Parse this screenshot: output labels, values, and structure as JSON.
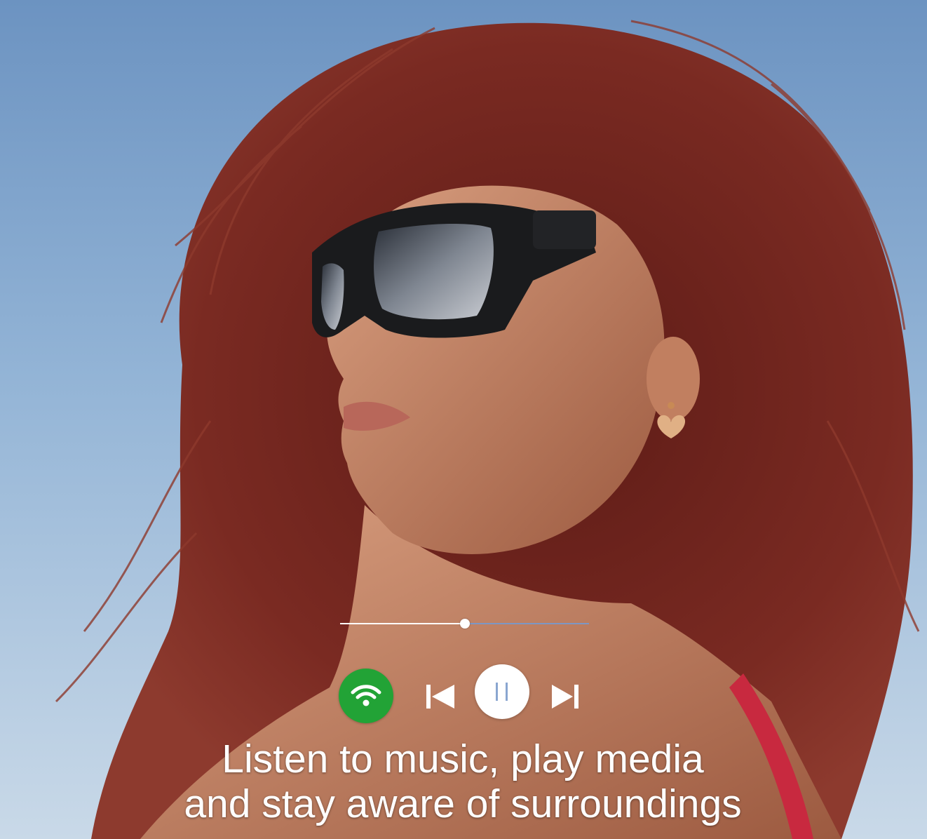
{
  "player": {
    "progress_fraction": 0.5,
    "icons": {
      "wifi": "wifi-icon",
      "previous": "skip-previous-icon",
      "pause": "pause-icon",
      "next": "skip-next-icon"
    },
    "colors": {
      "wifi_button": "#22a336",
      "progress_played": "#ffffff",
      "progress_remaining": "#7d97c4",
      "controls": "#ffffff"
    }
  },
  "caption": {
    "line1": "Listen to music, play media",
    "line2": "and stay aware of surroundings"
  }
}
